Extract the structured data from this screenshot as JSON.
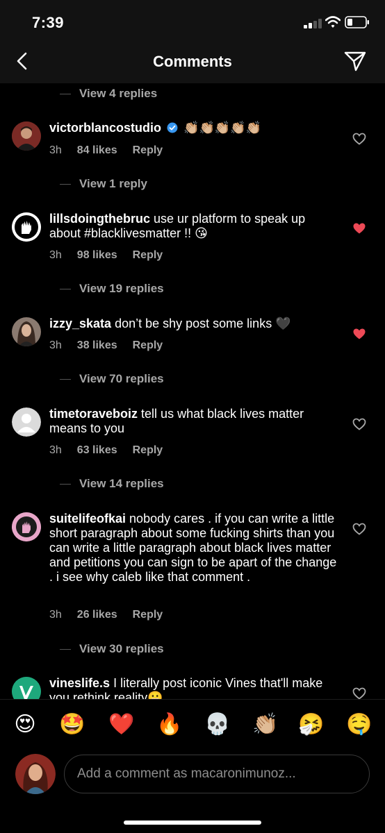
{
  "status": {
    "time": "7:39"
  },
  "header": {
    "title": "Comments"
  },
  "comments": [
    {
      "replies_label": "View 4 replies"
    },
    {
      "username": "victorblancostudio",
      "verified": true,
      "text": "👏🏼👏🏼👏🏼👏🏼👏🏼",
      "age": "3h",
      "likes": "84 likes",
      "reply": "Reply",
      "liked": false,
      "replies_label": "View 1 reply"
    },
    {
      "username": "lillsdoingthebruc",
      "text": "use ur platform to speak up about #blacklivesmatter !! 😘",
      "age": "3h",
      "likes": "98 likes",
      "reply": "Reply",
      "liked": true,
      "replies_label": "View 19 replies"
    },
    {
      "username": "izzy_skata",
      "text": "don’t be shy post some links 🖤",
      "age": "3h",
      "likes": "38 likes",
      "reply": "Reply",
      "liked": true,
      "replies_label": "View 70 replies"
    },
    {
      "username": "timetoraveboiz",
      "text": "tell us what black lives matter means to you",
      "age": "3h",
      "likes": "63 likes",
      "reply": "Reply",
      "liked": false,
      "replies_label": "View 14 replies"
    },
    {
      "username": "suitelifeofkai",
      "text": "nobody cares . if you can write a little short paragraph about some fucking shirts than you can write a little paragraph about black lives matter and petitions you can sign to be apart of the change . i see why caleb like that comment .",
      "age": "3h",
      "likes": "26 likes",
      "reply": "Reply",
      "liked": false,
      "replies_label": "View 30 replies"
    },
    {
      "username": "vineslife.s",
      "text": "I literally post iconic Vines that'll make you rethink reality😬",
      "liked": false
    }
  ],
  "emoji_bar": [
    "😍",
    "🤩",
    "❤️",
    "🔥",
    "💀",
    "👏🏼",
    "🤧",
    "🤤"
  ],
  "compose": {
    "placeholder": "Add a comment as macaronimunoz..."
  },
  "colors": {
    "like": "#ed4956",
    "muted": "#a8a8a8",
    "verified": "#3897f0"
  }
}
